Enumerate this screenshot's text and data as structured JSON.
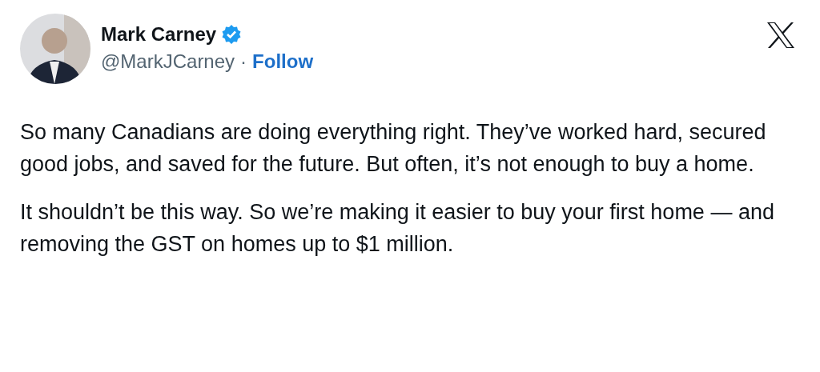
{
  "author": {
    "name": "Mark Carney",
    "verified": true,
    "handle": "@MarkJCarney",
    "separator": "·",
    "follow": "Follow"
  },
  "paragraphs": [
    "So many Canadians are doing everything right. They’ve worked hard, secured good jobs, and saved for the future. But often, it’s not enough to buy a home.",
    "It shouldn’t be this way. So we’re making it easier to buy your first home — and removing the GST on homes up to $1 million."
  ]
}
